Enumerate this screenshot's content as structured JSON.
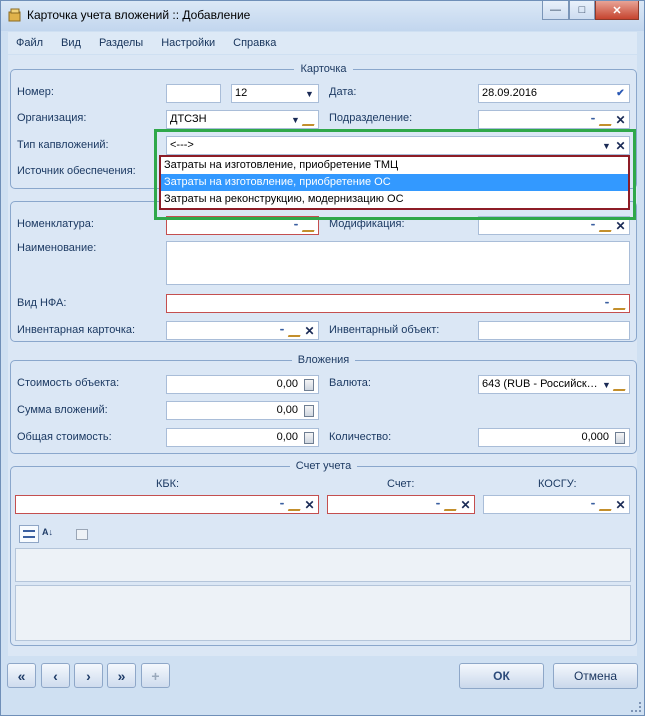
{
  "window": {
    "title": "Карточка учета вложений :: Добавление"
  },
  "menu": [
    "Файл",
    "Вид",
    "Разделы",
    "Настройки",
    "Справка"
  ],
  "card": {
    "title": "Карточка",
    "number_label": "Номер:",
    "number_value": "",
    "number2_value": "12",
    "date_label": "Дата:",
    "date_value": "28.09.2016",
    "org_label": "Организация:",
    "org_value": "ДТСЗН",
    "subdivision_label": "Подразделение:",
    "subdivision_value": "",
    "capital_type_label": "Тип капвложений:",
    "capital_type_value": "<--->",
    "source_label": "Источник обеспечения:",
    "dropdown_options": [
      "Затраты на изготовление, приобретение ТМЦ",
      "Затраты на изготовление, приобретение ОС",
      "Затраты на реконструкцию, модернизацию ОС"
    ],
    "dropdown_selected_index": 1
  },
  "item": {
    "nomenclature_label": "Номенклатура:",
    "modification_label": "Модификация:",
    "name_label": "Наименование:",
    "nfa_type_label": "Вид НФА:",
    "inventory_card_label": "Инвентарная карточка:",
    "inventory_object_label": "Инвентарный объект:"
  },
  "investments": {
    "title": "Вложения",
    "object_cost_label": "Стоимость объекта:",
    "object_cost_value": "0,00",
    "investment_sum_label": "Сумма вложений:",
    "investment_sum_value": "0,00",
    "total_cost_label": "Общая стоимость:",
    "total_cost_value": "0,00",
    "currency_label": "Валюта:",
    "currency_value": "643 (RUB - Российск…",
    "quantity_label": "Количество:",
    "quantity_value": "0,000"
  },
  "account": {
    "title": "Счет учета",
    "kbk_label": "КБК:",
    "account_label": "Счет:",
    "kosgu_label": "КОСГУ:"
  },
  "buttons": {
    "ok": "ОК",
    "cancel": "Отмена"
  },
  "colors": {
    "highlight": "#2fa84a",
    "selection": "#3399ff",
    "required_border": "#c44f4f"
  }
}
